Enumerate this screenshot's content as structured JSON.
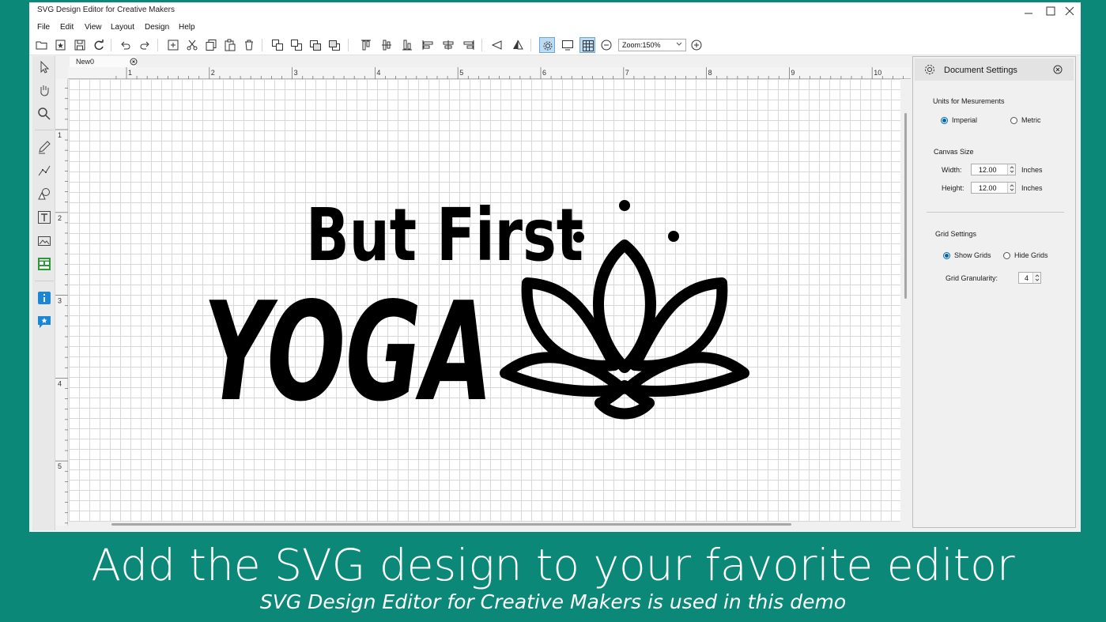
{
  "app": {
    "title": "SVG Design Editor for Creative Makers"
  },
  "menu": [
    "File",
    "Edit",
    "View",
    "Layout",
    "Design",
    "Help"
  ],
  "toolbar": {
    "zoom_value": "Zoom:150%"
  },
  "document": {
    "tab_name": "New0"
  },
  "rulers": {
    "horizontal": [
      "1",
      "2",
      "3",
      "4",
      "5",
      "6",
      "7",
      "8",
      "9",
      "10"
    ],
    "vertical": [
      "1",
      "2",
      "3",
      "4",
      "5"
    ]
  },
  "canvas": {
    "line1": "But First",
    "line2": "YOGA"
  },
  "panel": {
    "title": "Document Settings",
    "units_label": "Units for Mesurements",
    "imperial_label": "Imperial",
    "metric_label": "Metric",
    "units_selected": "Imperial",
    "canvas_size_label": "Canvas Size",
    "width_label": "Width:",
    "width_value": "12.00",
    "width_unit": "Inches",
    "height_label": "Height:",
    "height_value": "12.00",
    "height_unit": "Inches",
    "grid_settings_label": "Grid Settings",
    "show_grids_label": "Show Grids",
    "hide_grids_label": "Hide Grids",
    "grid_selected": "Show Grids",
    "granularity_label": "Grid Granularity:",
    "granularity_value": "4"
  },
  "caption": {
    "headline": "Add the SVG design to your favorite editor",
    "subline": "SVG Design Editor for Creative Makers is used in this demo"
  },
  "colors": {
    "background": "#0b8877",
    "accent": "#0066b3"
  }
}
